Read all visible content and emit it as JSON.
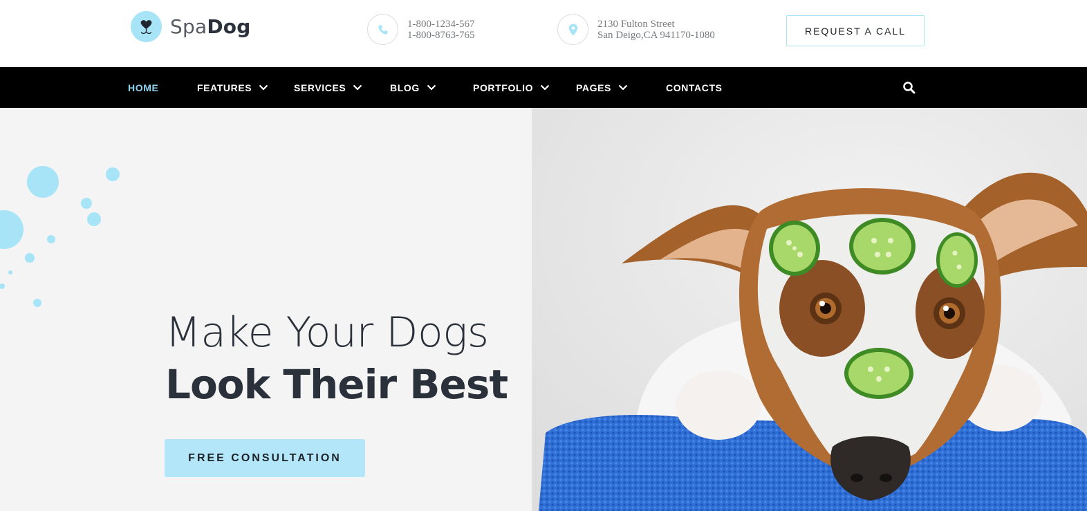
{
  "brand": {
    "name_light": "Spa",
    "name_bold": "Dog",
    "accent": "#a8e4f7"
  },
  "contacts": {
    "phone": {
      "icon": "phone-icon",
      "line1": "1-800-1234-567",
      "line2": "1-800-8763-765"
    },
    "address": {
      "icon": "map-pin-icon",
      "line1": "2130 Fulton Street",
      "line2": "San Deigo,CA 941170-1080"
    }
  },
  "header": {
    "request_label": "REQUEST A CALL"
  },
  "nav": {
    "items": [
      {
        "label": "HOME",
        "active": true,
        "dropdown": false
      },
      {
        "label": "FEATURES",
        "active": false,
        "dropdown": true
      },
      {
        "label": "SERVICES",
        "active": false,
        "dropdown": true
      },
      {
        "label": "BLOG",
        "active": false,
        "dropdown": true
      },
      {
        "label": "PORTFOLIO",
        "active": false,
        "dropdown": true
      },
      {
        "label": "PAGES",
        "active": false,
        "dropdown": true
      },
      {
        "label": "CONTACTS",
        "active": false,
        "dropdown": false
      }
    ],
    "search_icon": "search-icon",
    "active_color": "#8fd8f3"
  },
  "hero": {
    "line1": "Make Your Dogs",
    "line2": "Look Their Best",
    "cta_label": "FREE CONSULTATION",
    "image_subject": "dog-with-cucumber-face-mask"
  }
}
